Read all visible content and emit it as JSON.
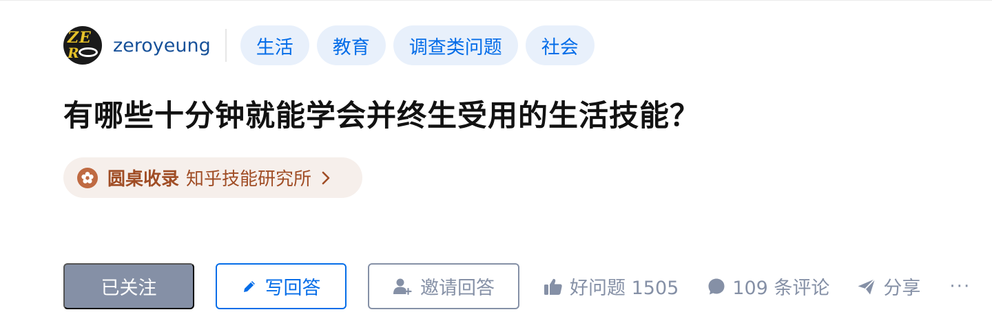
{
  "author": {
    "name": "zeroyeung",
    "avatar_icon": "avatar-ze-ro-logo"
  },
  "topics": [
    {
      "label": "生活"
    },
    {
      "label": "教育"
    },
    {
      "label": "调查类问题"
    },
    {
      "label": "社会"
    }
  ],
  "question": {
    "title": "有哪些十分钟就能学会并终生受用的生活技能？"
  },
  "roundtable": {
    "icon": "roundtable-flower-icon",
    "label": "圆桌收录",
    "name": "知乎技能研究所",
    "arrow_icon": "chevron-right-icon"
  },
  "actions": {
    "follow_label": "已关注",
    "answer_label": "写回答",
    "answer_icon": "pencil-icon",
    "invite_label": "邀请回答",
    "invite_icon": "add-user-icon"
  },
  "meta": {
    "good_question_label": "好问题 1505",
    "good_question_icon": "thumbs-up-icon",
    "comments_label": "109 条评论",
    "comments_icon": "comment-bubble-icon",
    "share_label": "分享",
    "share_icon": "paper-plane-icon",
    "more_label": "···"
  },
  "colors": {
    "brand_blue": "#056de8",
    "link_blue": "#175199",
    "tag_bg": "#e8f0fb",
    "gray": "#8590a6",
    "roundtable_bg": "#f6efeb",
    "roundtable_text": "#a04d25",
    "title_text": "#121212"
  }
}
